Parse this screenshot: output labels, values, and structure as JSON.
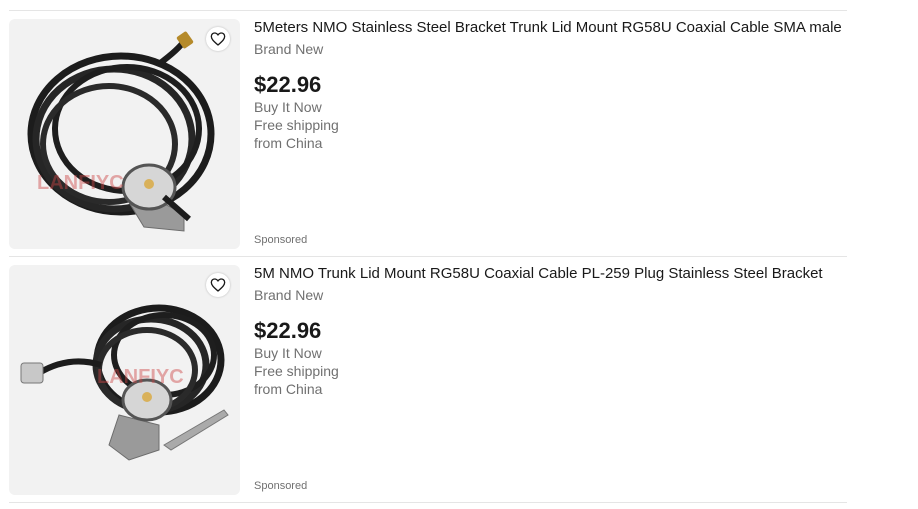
{
  "listings": [
    {
      "title": "5Meters NMO Stainless Steel Bracket Trunk Lid Mount RG58U Coaxial Cable SMA male",
      "condition": "Brand New",
      "price": "$22.96",
      "format": "Buy It Now",
      "shipping": "Free shipping",
      "location": "from China",
      "sponsored": "Sponsored",
      "image_watermark": "LANFIYC",
      "watch_icon": "heart-icon"
    },
    {
      "title": "5M NMO Trunk Lid Mount RG58U Coaxial Cable PL-259 Plug Stainless Steel Bracket",
      "condition": "Brand New",
      "price": "$22.96",
      "format": "Buy It Now",
      "shipping": "Free shipping",
      "location": "from China",
      "sponsored": "Sponsored",
      "image_watermark": "LANFIYC",
      "watch_icon": "heart-icon"
    }
  ]
}
